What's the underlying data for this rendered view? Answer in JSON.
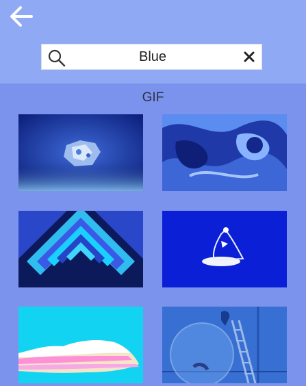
{
  "header": {
    "back_icon": "arrow-left-icon",
    "search": {
      "value": "Blue",
      "icon": "search-icon",
      "clear_icon": "close-icon"
    }
  },
  "section": {
    "title": "GIF"
  },
  "colors": {
    "header_bg": "#8fa9f4",
    "page_bg": "#7b93ec"
  },
  "gifs": [
    {
      "name": "gif-crystal-tile"
    },
    {
      "name": "gif-swirl-tile"
    },
    {
      "name": "gif-diamond-tunnel-tile"
    },
    {
      "name": "gif-spotlight-figure-tile"
    },
    {
      "name": "gif-pink-cloud-tile"
    },
    {
      "name": "gif-fishbowl-room-tile"
    }
  ]
}
